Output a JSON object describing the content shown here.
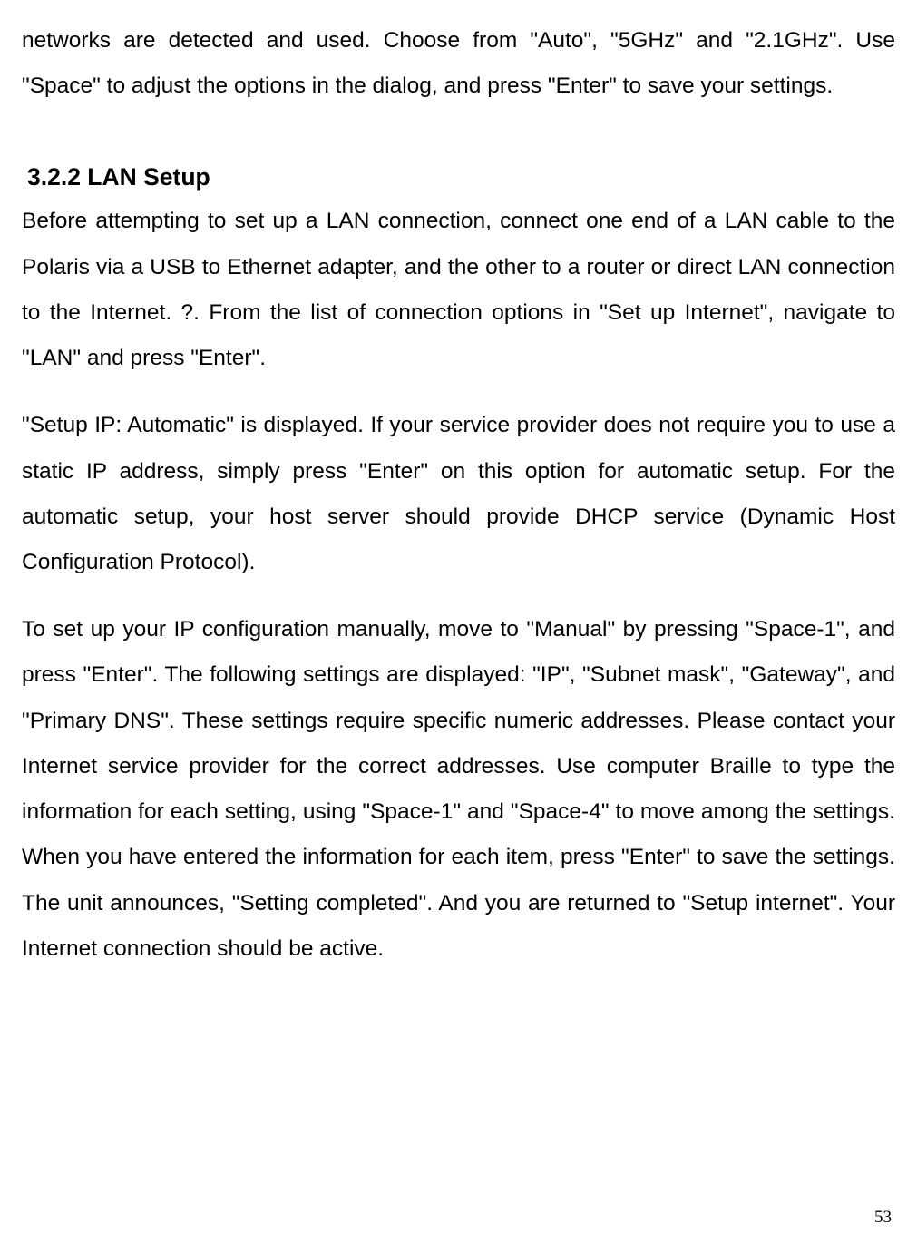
{
  "intro_paragraph": "networks are detected and used. Choose from \"Auto\", \"5GHz\" and \"2.1GHz\". Use \"Space\" to adjust the options in the dialog, and press \"Enter\" to save your settings.",
  "heading": "3.2.2 LAN Setup",
  "paragraphs": [
    "Before attempting to set up a LAN connection, connect one end of a LAN cable to the Polaris via a USB to Ethernet adapter, and the other to a router or direct LAN connection to the Internet. ?. From the list of connection options in \"Set up Internet\", navigate to \"LAN\" and press \"Enter\".",
    "\"Setup IP: Automatic\" is displayed. If your service provider does not require you to use a static IP address, simply press \"Enter\" on this option for automatic setup. For the automatic setup, your host server should provide DHCP service (Dynamic Host Configuration Protocol).",
    "To set up your IP configuration manually, move to \"Manual\" by pressing \"Space-1\", and press \"Enter\". The following settings are displayed: \"IP\", \"Subnet mask\", \"Gateway\", and \"Primary DNS\". These settings require specific numeric addresses. Please contact your Internet service provider for the correct addresses. Use computer Braille to type the information for each setting, using \"Space-1\" and \"Space-4\" to move among the settings. When you have entered the information for each item, press \"Enter\" to save the settings. The unit announces, \"Setting completed\". And you are returned to \"Setup internet\". Your Internet connection should be active."
  ],
  "page_number": "53"
}
